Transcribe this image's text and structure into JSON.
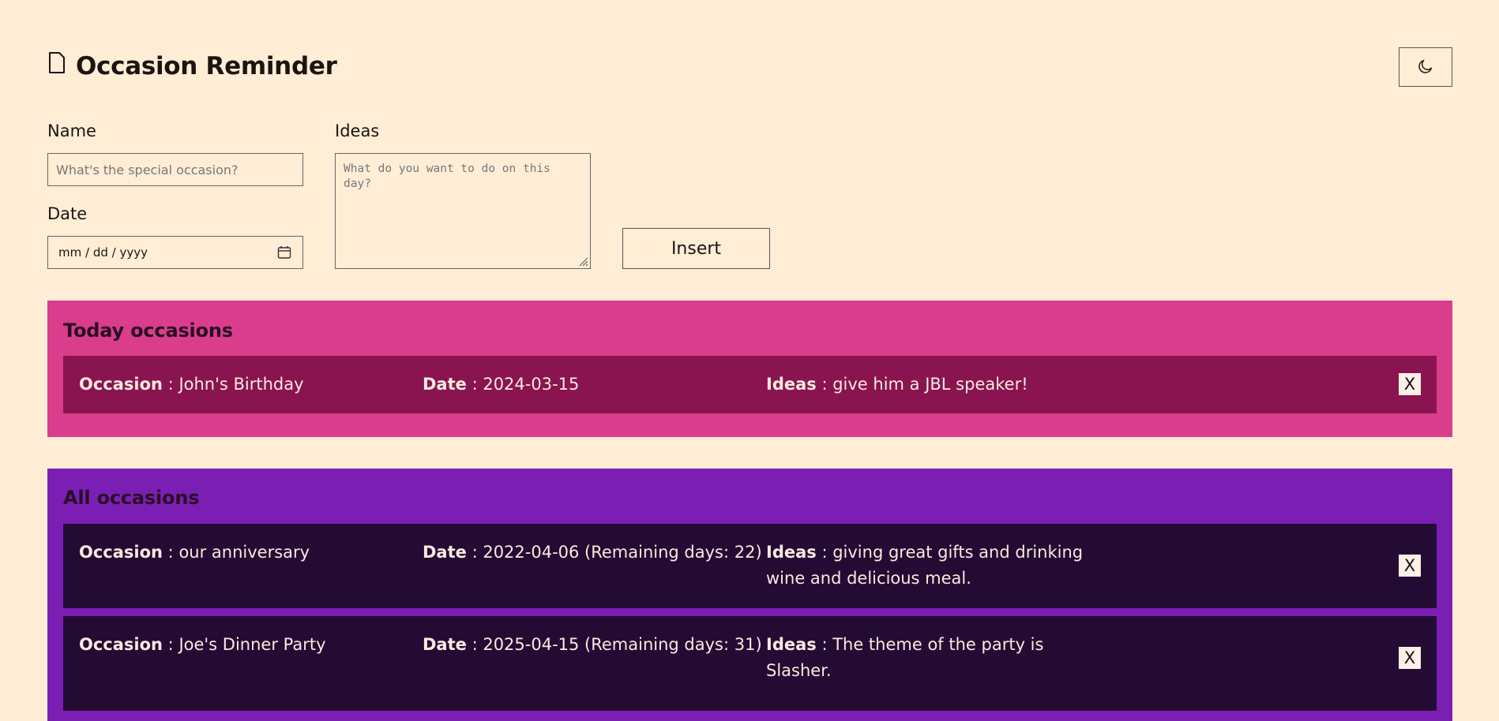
{
  "app": {
    "title": "Occasion Reminder",
    "title_icon": "document-icon",
    "theme_toggle_icon": "moon-icon"
  },
  "form": {
    "name_label": "Name",
    "name_placeholder": "What's the special occasion?",
    "date_label": "Date",
    "date_placeholder": "mm / dd / yyyy",
    "ideas_label": "Ideas",
    "ideas_placeholder": "What do you want to do on this day?",
    "insert_label": "Insert"
  },
  "today": {
    "title": "Today occasions",
    "items": [
      {
        "occasion_label": "Occasion",
        "occasion": "John's Birthday",
        "date_label": "Date",
        "date": "2024-03-15",
        "ideas_label": "Ideas",
        "ideas": "give him a JBL speaker!",
        "delete_label": "X"
      }
    ]
  },
  "all": {
    "title": "All occasions",
    "items": [
      {
        "occasion_label": "Occasion",
        "occasion": "our anniversary",
        "date_label": "Date",
        "date": "2022-04-06 (Remaining days: 22)",
        "ideas_label": "Ideas",
        "ideas": "giving great gifts and drinking wine and delicious meal.",
        "delete_label": "X"
      },
      {
        "occasion_label": "Occasion",
        "occasion": "Joe's Dinner Party",
        "date_label": "Date",
        "date": "2025-04-15 (Remaining days: 31)",
        "ideas_label": "Ideas",
        "ideas": "The theme of the party is Slasher.",
        "delete_label": "X"
      }
    ]
  },
  "colors": {
    "background": "#ffedd6",
    "today_section": "#d93d8c",
    "today_card": "#89144f",
    "all_section": "#7b1fb4",
    "all_card": "#240b33"
  }
}
